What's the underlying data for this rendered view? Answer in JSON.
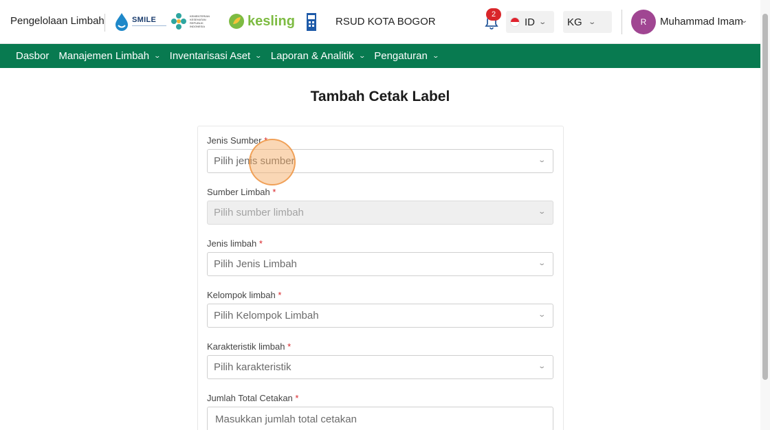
{
  "header": {
    "app_name": "Pengelolaan Limbah",
    "logos": {
      "smile": "SMILE",
      "kemenkes": "KEMENTERIAN KESEHATAN REPUBLIK INDONESIA",
      "kesling": "kesling"
    },
    "hospital_name": "RSUD KOTA BOGOR",
    "notifications_count": "2",
    "language": "ID",
    "unit": "KG",
    "user": {
      "initial": "R",
      "name": "Muhammad Imam"
    }
  },
  "nav": {
    "items": [
      {
        "label": "Dasbor",
        "has_dropdown": false
      },
      {
        "label": "Manajemen Limbah",
        "has_dropdown": true
      },
      {
        "label": "Inventarisasi Aset",
        "has_dropdown": true
      },
      {
        "label": "Laporan & Analitik",
        "has_dropdown": true
      },
      {
        "label": "Pengaturan",
        "has_dropdown": true
      }
    ]
  },
  "page": {
    "title": "Tambah Cetak Label"
  },
  "form": {
    "jenis_sumber": {
      "label": "Jenis Sumber",
      "required": "*",
      "placeholder": "Pilih jenis sumber"
    },
    "sumber_limbah": {
      "label": "Sumber Limbah",
      "required": "*",
      "placeholder": "Pilih sumber limbah"
    },
    "jenis_limbah": {
      "label": "Jenis limbah",
      "required": "*",
      "placeholder": "Pilih Jenis Limbah"
    },
    "kelompok_limbah": {
      "label": "Kelompok limbah",
      "required": "*",
      "placeholder": "Pilih Kelompok Limbah"
    },
    "karakteristik_limbah": {
      "label": "Karakteristik limbah",
      "required": "*",
      "placeholder": "Pilih karakteristik"
    },
    "jumlah_total_cetakan": {
      "label": "Jumlah Total Cetakan",
      "required": "*",
      "placeholder": "Masukkan jumlah total cetakan"
    }
  },
  "colors": {
    "nav_bg": "#087a50",
    "avatar_bg": "#a04692",
    "badge_bg": "#d9262a",
    "required_mark": "#d9262a"
  }
}
